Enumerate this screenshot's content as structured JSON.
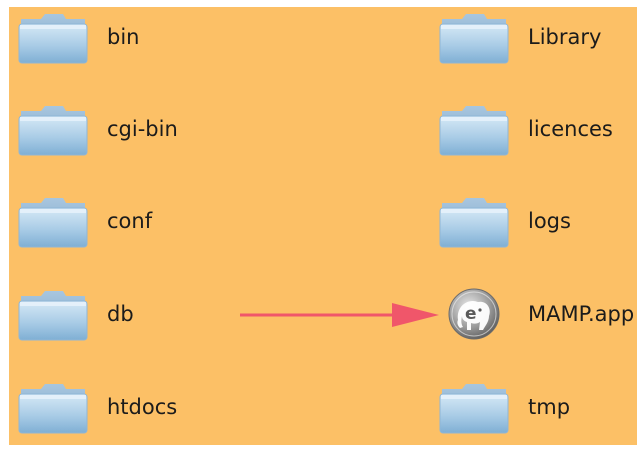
{
  "window": {
    "background_color": "#fcc066",
    "annotation_arrow_color": "#f0566a"
  },
  "items": [
    {
      "label": "bin",
      "icon": "folder-icon"
    },
    {
      "label": "cgi-bin",
      "icon": "folder-icon"
    },
    {
      "label": "conf",
      "icon": "folder-icon"
    },
    {
      "label": "db",
      "icon": "folder-icon"
    },
    {
      "label": "htdocs",
      "icon": "folder-icon"
    },
    {
      "label": "Library",
      "icon": "folder-icon"
    },
    {
      "label": "licences",
      "icon": "folder-icon"
    },
    {
      "label": "logs",
      "icon": "folder-icon"
    },
    {
      "label": "MAMP.app",
      "icon": "mamp-elephant-app-icon"
    },
    {
      "label": "tmp",
      "icon": "folder-icon"
    }
  ]
}
